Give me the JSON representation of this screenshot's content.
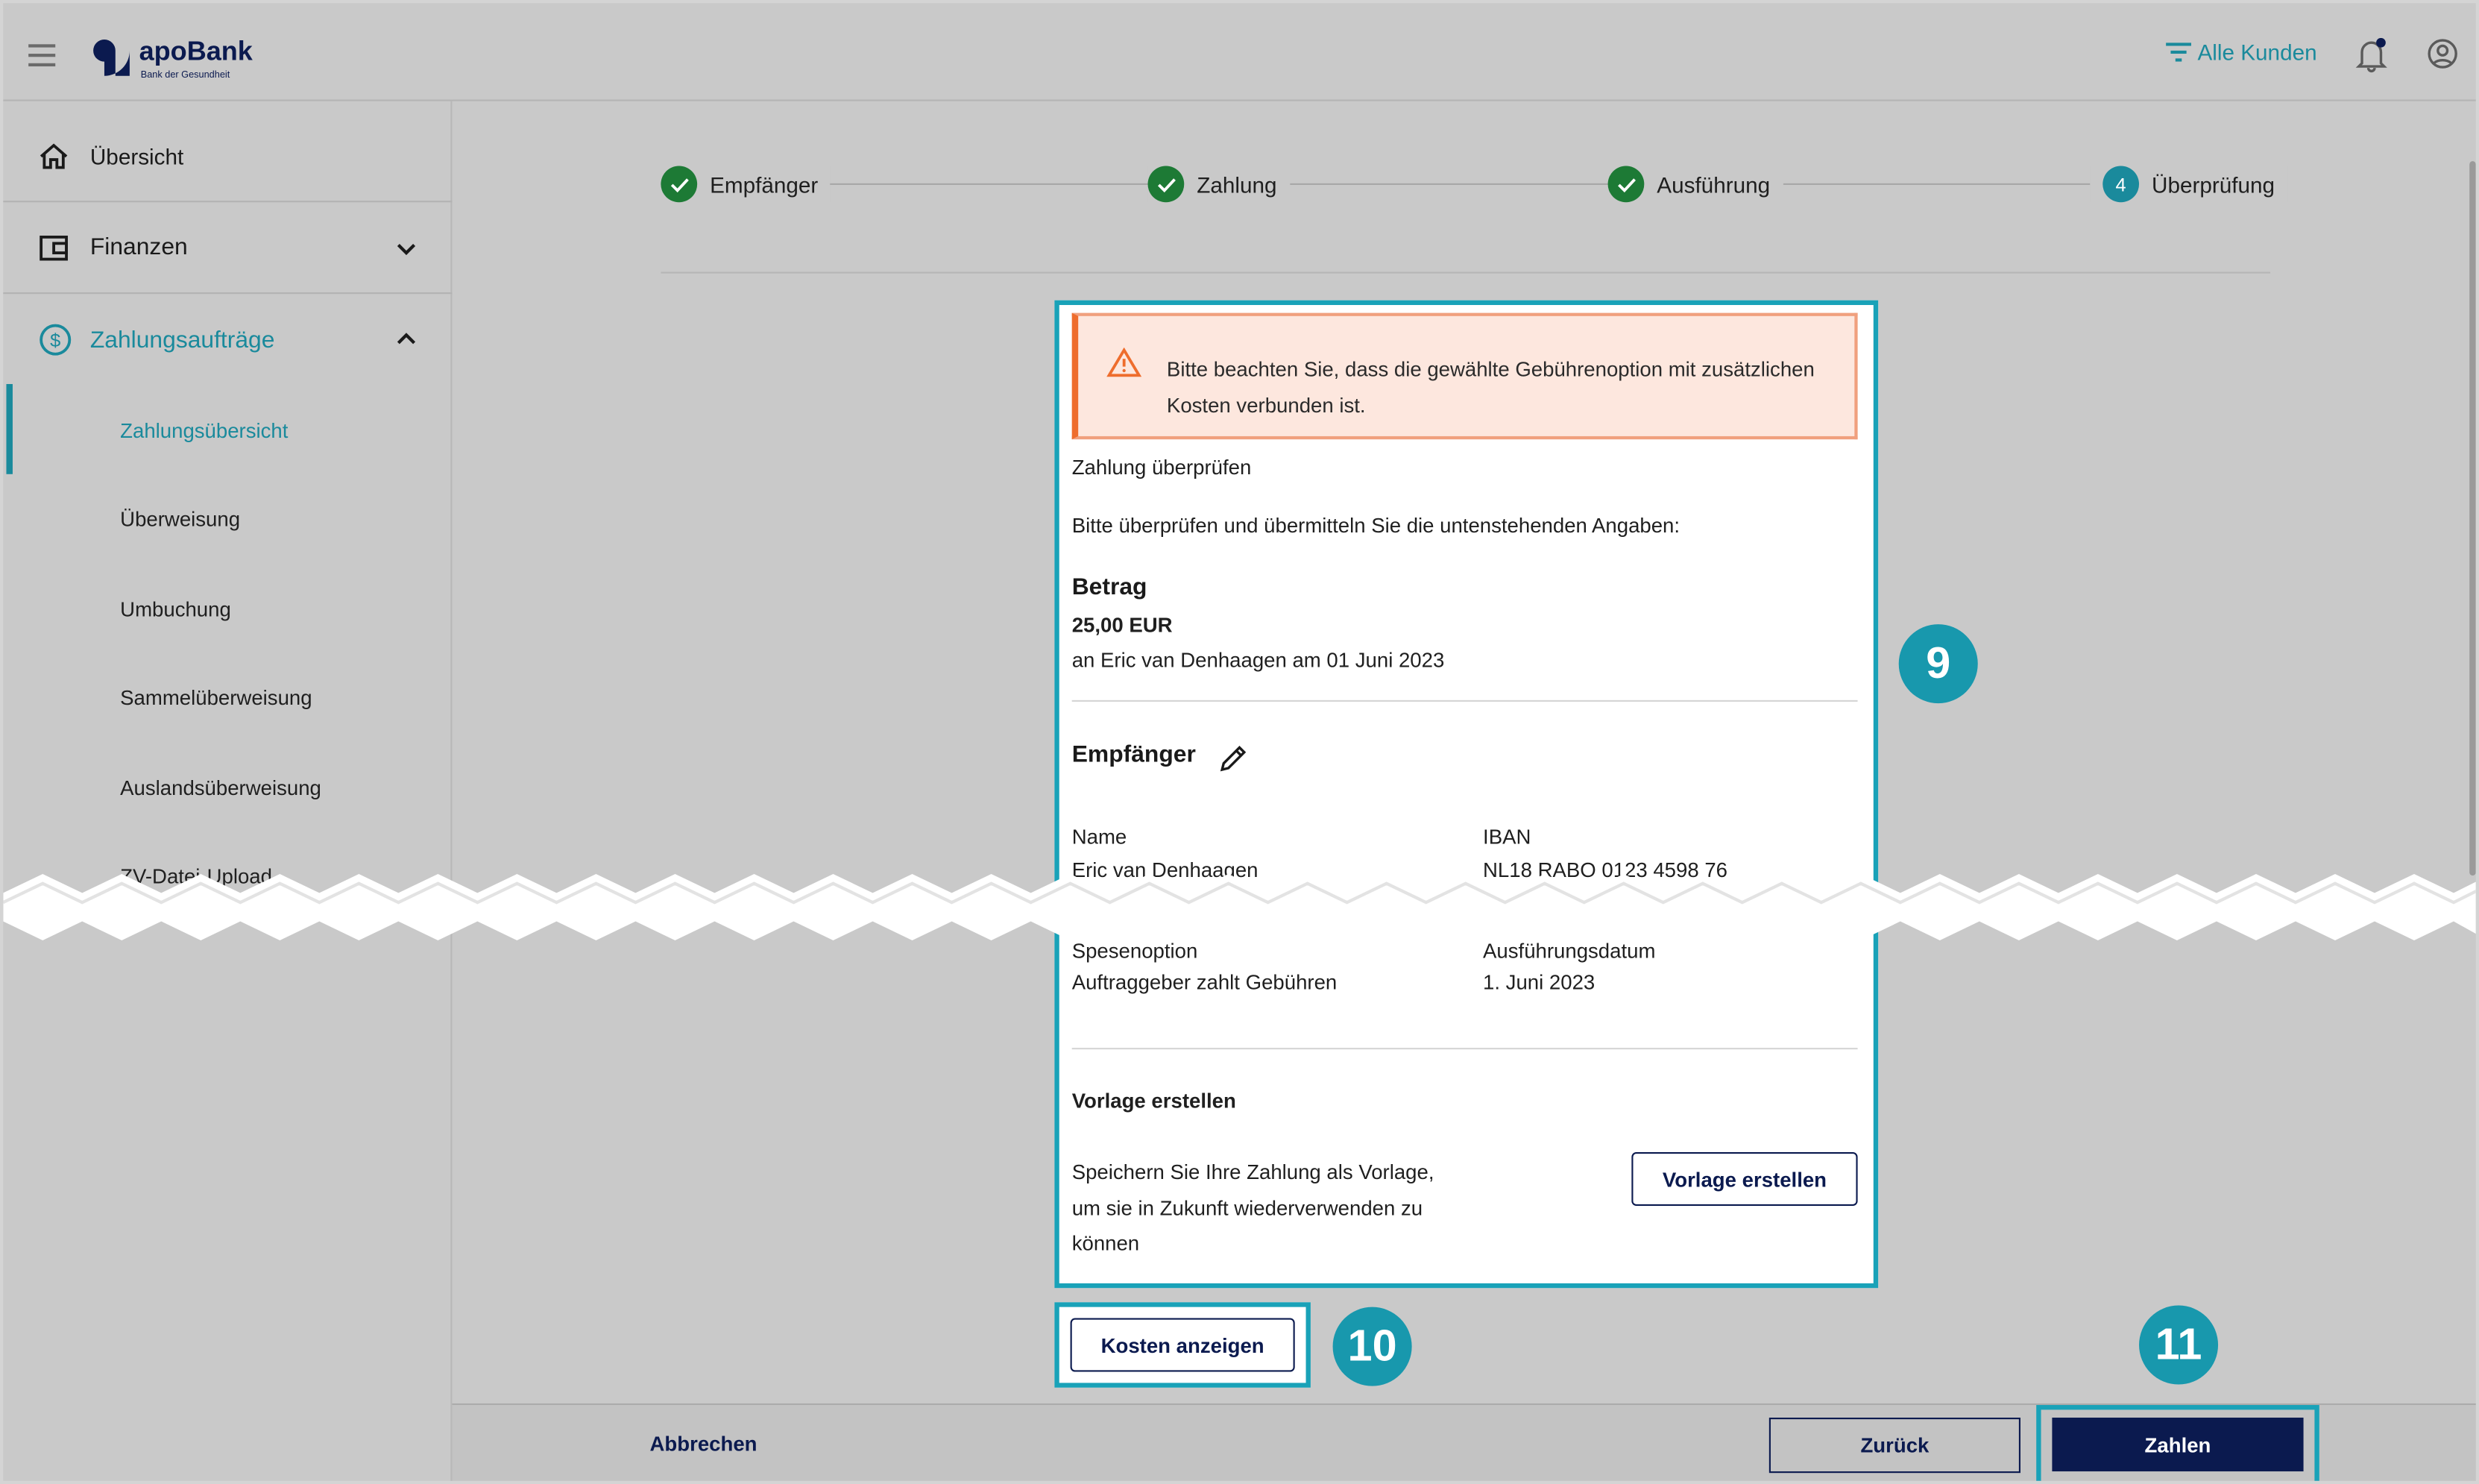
{
  "header": {
    "logo_name": "apoBank",
    "logo_tagline": "Bank der Gesundheit",
    "filter_label": "Alle Kunden"
  },
  "sidebar": {
    "overview": "Übersicht",
    "finances": "Finanzen",
    "payments": "Zahlungsaufträge",
    "sub_items": [
      "Zahlungsübersicht",
      "Überweisung",
      "Umbuchung",
      "Sammelüberweisung",
      "Auslandsüberweisung",
      "ZV-Datei-Upload"
    ]
  },
  "stepper": {
    "steps": [
      {
        "label": "Empfänger",
        "state": "done"
      },
      {
        "label": "Zahlung",
        "state": "done"
      },
      {
        "label": "Ausführung",
        "state": "done"
      },
      {
        "label": "Überprüfung",
        "state": "current",
        "number": "4"
      }
    ]
  },
  "review": {
    "warning": "Bitte beachten Sie, dass die gewählte Gebührenoption mit zusätzlichen Kosten verbunden ist.",
    "title": "Zahlung überprüfen",
    "instruction": "Bitte überprüfen und übermitteln Sie die untenstehenden Angaben:",
    "amount_heading": "Betrag",
    "amount_value": "25,00 EUR",
    "amount_detail": "an Eric van Denhaagen am 01 Juni 2023",
    "recipient_heading": "Empfänger",
    "name_label": "Name",
    "name_value": "Eric van Denhaagen",
    "iban_label": "IBAN",
    "iban_value": "NL18 RABO 0123 4598 76",
    "fee_label": "Spesenoption",
    "fee_value": "Auftraggeber zahlt Gebühren",
    "date_label": "Ausführungsdatum",
    "date_value": "1. Juni 2023",
    "template_heading": "Vorlage erstellen",
    "template_text": "Speichern Sie Ihre Zahlung als Vorlage, um sie in Zukunft wiederverwenden zu können",
    "template_button": "Vorlage erstellen"
  },
  "actions": {
    "show_costs": "Kosten anzeigen",
    "cancel": "Abbrechen",
    "back": "Zurück",
    "pay": "Zahlen"
  },
  "callouts": [
    "9",
    "10",
    "11"
  ],
  "colors": {
    "brand_navy": "#0b1a4f",
    "accent_teal": "#1a8a9c",
    "callout": "#19a2b8",
    "success": "#1d7a35",
    "warning": "#ee6d2d"
  }
}
